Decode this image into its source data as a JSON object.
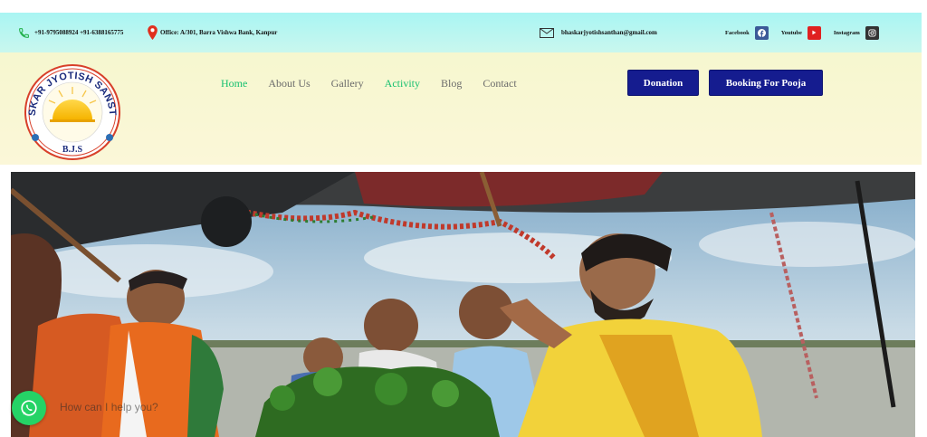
{
  "topbar": {
    "phone": "+91-9795088924 +91-6388165775",
    "address": "Office: A/301, Barra Vishwa Bank, Kanpur",
    "email": "bhaskarjyotishsanthan@gmail.com",
    "social": [
      {
        "label": "Facebook",
        "icon": "facebook-icon",
        "color": "#3b5998"
      },
      {
        "label": "Youtube",
        "icon": "youtube-icon",
        "color": "#e02020"
      },
      {
        "label": "Instagram",
        "icon": "instagram-icon",
        "color": "#333333"
      }
    ]
  },
  "logo": {
    "arc_text": "BHASKAR JYOTISH SANSTHAN",
    "initials": "B.J.S"
  },
  "nav": {
    "items": [
      {
        "label": "Home",
        "active": true
      },
      {
        "label": "About Us",
        "active": false
      },
      {
        "label": "Gallery",
        "active": false
      },
      {
        "label": "Activity",
        "active": true
      },
      {
        "label": "Blog",
        "active": false
      },
      {
        "label": "Contact",
        "active": false
      }
    ]
  },
  "actions": {
    "donation": "Donation",
    "booking": "Booking For Pooja"
  },
  "chat": {
    "text": "How can I help you?"
  },
  "colors": {
    "brand_blue": "#151c8f",
    "active_green": "#17c070",
    "whatsapp_green": "#25d366"
  }
}
